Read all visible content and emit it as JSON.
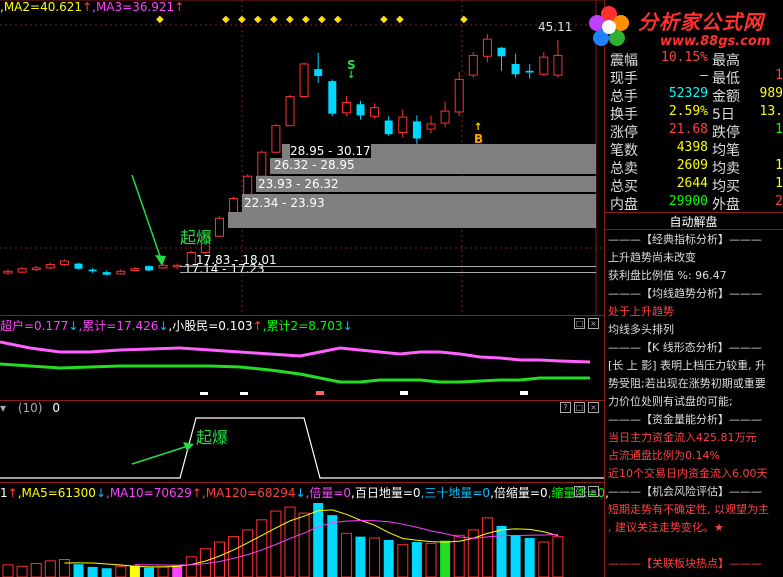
{
  "top_indicators": [
    {
      "text": ",MA2=40.621",
      "color": "#ffff00"
    },
    {
      "text": "↑",
      "color": "#ff4040"
    },
    {
      "text": ",MA3=36.921",
      "color": "#ff40ff"
    },
    {
      "text": "↑",
      "color": "#ff4040"
    }
  ],
  "price_label": "45.11",
  "logo": {
    "text": "分析家公式网",
    "url": "www.88gs.com"
  },
  "signals": {
    "s": "S",
    "b": "B"
  },
  "boxes": [
    "28.95 - 30.17",
    "26.32 - 28.95",
    "23.93 - 26.32",
    "22.34 - 23.93",
    "17.83 - 18.01",
    "17.14 - 17.23"
  ],
  "qiba": "起爆",
  "panel1_indicators": [
    {
      "text": "超户=0.177",
      "color": "#ff40ff"
    },
    {
      "text": "↓",
      "color": "#00c0ff"
    },
    {
      "text": ",累计=17.426",
      "color": "#ff40ff"
    },
    {
      "text": "↓",
      "color": "#00c0ff"
    },
    {
      "text": ",小股民=0.103",
      "color": "#ffffff"
    },
    {
      "text": "↑",
      "color": "#ff4040"
    },
    {
      "text": ",累计2=8.703",
      "color": "#00ff00"
    },
    {
      "text": "↓",
      "color": "#00c0ff"
    }
  ],
  "panel2_header": {
    "prefix": "▾",
    "paren": "(10)",
    "value": "0"
  },
  "panel3_indicators": [
    {
      "text": "1",
      "color": "#ffffff"
    },
    {
      "text": "↑",
      "color": "#ff4040"
    },
    {
      "text": ",MA5=61300",
      "color": "#ffff00"
    },
    {
      "text": "↓",
      "color": "#00c0ff"
    },
    {
      "text": ",MA10=70629",
      "color": "#ff40ff"
    },
    {
      "text": "↑",
      "color": "#ff4040"
    },
    {
      "text": ",MA120=68294",
      "color": "#ff4040"
    },
    {
      "text": "↓",
      "color": "#00c0ff"
    },
    {
      "text": ",倍量=0",
      "color": "#ff40ff"
    },
    {
      "text": ",百日地量=0",
      "color": "#ffffff"
    },
    {
      "text": ",三十地量=0",
      "color": "#00c0ff"
    },
    {
      "text": ",倍缩量=0",
      "color": "#ffffff"
    },
    {
      "text": ",缩量涨=0",
      "color": "#00ff00"
    },
    {
      "text": ",",
      "color": "#ffffff"
    }
  ],
  "quote": {
    "rows": [
      {
        "l1": "震幅",
        "v1": "10.15%",
        "c1": "#ff4040",
        "l2": "最高",
        "v2": "",
        "c2": "#ff4040"
      },
      {
        "l1": "现手",
        "v1": "—",
        "c1": "#dddddd",
        "l2": "最低",
        "v2": "1",
        "c2": "#ff4040"
      },
      {
        "l1": "总手",
        "v1": "52329",
        "c1": "#00ffff",
        "l2": "金额",
        "v2": "989",
        "c2": "#ffff00"
      },
      {
        "l1": "换手",
        "v1": "2.59%",
        "c1": "#ffff00",
        "l2": "5日",
        "v2": "13.",
        "c2": "#ffff00"
      },
      {
        "l1": "涨停",
        "v1": "21.68",
        "c1": "#ff4040",
        "l2": "跌停",
        "v2": "1",
        "c2": "#00ff00"
      },
      {
        "l1": "笔数",
        "v1": "4398",
        "c1": "#ffff00",
        "l2": "均笔",
        "v2": "",
        "c2": "#ffff00"
      },
      {
        "l1": "总卖",
        "v1": "2609",
        "c1": "#ffff00",
        "l2": "均卖",
        "v2": "1",
        "c2": "#ffff00"
      },
      {
        "l1": "总买",
        "v1": "2644",
        "c1": "#ffff00",
        "l2": "均买",
        "v2": "1",
        "c2": "#ffff00"
      },
      {
        "l1": "内盘",
        "v1": "29900",
        "c1": "#00ff00",
        "l2": "外盘",
        "v2": "2",
        "c2": "#ff4040"
      }
    ]
  },
  "auto_title": "自动解盘",
  "analysis": [
    {
      "text": "———【经典指标分析】———",
      "color": "#dddddd"
    },
    {
      "text": "上升趋势尚未改变",
      "color": "#dddddd"
    },
    {
      "text": "获利盘比例值 %: 96.47",
      "color": "#dddddd"
    },
    {
      "text": "———【均线趋势分析】———",
      "color": "#dddddd"
    },
    {
      "text": "处于上升趋势",
      "color": "#ff4040"
    },
    {
      "text": "均线多头排列",
      "color": "#dddddd"
    },
    {
      "text": "———【K 线形态分析】———",
      "color": "#dddddd"
    },
    {
      "text": "[长 上 影] 表明上档压力较重, 升",
      "color": "#dddddd"
    },
    {
      "text": "势受阻;若出现在涨势初期或重要",
      "color": "#dddddd"
    },
    {
      "text": "力价位处则有试盘的可能;",
      "color": "#dddddd"
    },
    {
      "text": "———【资金量能分析】———",
      "color": "#dddddd"
    },
    {
      "text": "当日主力资金流入425.81万元",
      "color": "#ff4040"
    },
    {
      "text": "占流通盘比例为0.14%",
      "color": "#ff4040"
    },
    {
      "text": "近10个交易日内资金流入6.00天",
      "color": "#ff4040"
    },
    {
      "text": "———【机会风险评估】———",
      "color": "#dddddd"
    },
    {
      "text": "短期走势有不确定性, 以观望为主",
      "color": "#ff4040"
    },
    {
      "text": ", 建议关注走势变化。★",
      "color": "#ff4040"
    },
    {
      "text": "",
      "color": "#dddddd"
    },
    {
      "text": "———【关联板块热点】———",
      "color": "#ff4040"
    }
  ],
  "chart_data": {
    "type": "candlestick",
    "price_tick": "45.11",
    "candles": [
      {
        "o": 17.2,
        "c": 17.4,
        "h": 17.6,
        "l": 17.0
      },
      {
        "o": 17.3,
        "c": 17.7,
        "h": 17.9,
        "l": 17.2
      },
      {
        "o": 17.6,
        "c": 17.8,
        "h": 18.0,
        "l": 17.4
      },
      {
        "o": 17.8,
        "c": 18.2,
        "h": 18.4,
        "l": 17.6
      },
      {
        "o": 18.2,
        "c": 18.6,
        "h": 18.8,
        "l": 18.0
      },
      {
        "o": 18.3,
        "c": 17.7,
        "h": 18.4,
        "l": 17.6
      },
      {
        "o": 17.6,
        "c": 17.4,
        "h": 17.8,
        "l": 17.2
      },
      {
        "o": 17.3,
        "c": 17.0,
        "h": 17.5,
        "l": 16.9
      },
      {
        "o": 17.1,
        "c": 17.4,
        "h": 17.6,
        "l": 17.0
      },
      {
        "o": 17.5,
        "c": 17.7,
        "h": 17.9,
        "l": 17.4
      },
      {
        "o": 18.0,
        "c": 17.5,
        "h": 18.1,
        "l": 17.4
      },
      {
        "o": 17.8,
        "c": 18.1,
        "h": 18.3,
        "l": 17.7
      },
      {
        "o": 18.0,
        "c": 18.1,
        "h": 18.3,
        "l": 17.6
      },
      {
        "o": 18.1,
        "c": 19.6,
        "h": 19.8,
        "l": 18.0
      },
      {
        "o": 19.6,
        "c": 21.5,
        "h": 21.7,
        "l": 19.4
      },
      {
        "o": 21.5,
        "c": 23.6,
        "h": 23.8,
        "l": 21.4
      },
      {
        "o": 23.6,
        "c": 25.9,
        "h": 26.1,
        "l": 23.5
      },
      {
        "o": 25.9,
        "c": 28.5,
        "h": 28.7,
        "l": 25.8
      },
      {
        "o": 28.5,
        "c": 31.3,
        "h": 31.5,
        "l": 28.4
      },
      {
        "o": 31.3,
        "c": 34.4,
        "h": 34.6,
        "l": 31.2
      },
      {
        "o": 34.4,
        "c": 37.8,
        "h": 38.0,
        "l": 34.3
      },
      {
        "o": 37.8,
        "c": 41.6,
        "h": 41.8,
        "l": 37.7
      },
      {
        "o": 41.0,
        "c": 40.2,
        "h": 42.9,
        "l": 39.4
      },
      {
        "o": 39.6,
        "c": 35.8,
        "h": 39.8,
        "l": 35.5
      },
      {
        "o": 35.9,
        "c": 37.1,
        "h": 37.9,
        "l": 35.5
      },
      {
        "o": 36.9,
        "c": 35.6,
        "h": 37.3,
        "l": 35.1
      },
      {
        "o": 35.5,
        "c": 36.5,
        "h": 37.0,
        "l": 35.2
      },
      {
        "o": 35.0,
        "c": 33.4,
        "h": 35.5,
        "l": 33.2
      },
      {
        "o": 33.6,
        "c": 35.4,
        "h": 36.3,
        "l": 33.0
      },
      {
        "o": 34.9,
        "c": 32.9,
        "h": 35.6,
        "l": 31.9
      },
      {
        "o": 34.0,
        "c": 34.6,
        "h": 35.6,
        "l": 33.5
      },
      {
        "o": 34.7,
        "c": 36.1,
        "h": 37.2,
        "l": 34.2
      },
      {
        "o": 36.0,
        "c": 39.8,
        "h": 40.7,
        "l": 35.5
      },
      {
        "o": 40.3,
        "c": 42.6,
        "h": 43.0,
        "l": 40.0
      },
      {
        "o": 42.5,
        "c": 44.5,
        "h": 45.1,
        "l": 41.8
      },
      {
        "o": 43.5,
        "c": 42.5,
        "h": 43.6,
        "l": 40.8
      },
      {
        "o": 41.6,
        "c": 40.4,
        "h": 42.8,
        "l": 40.0
      },
      {
        "o": 40.8,
        "c": 40.6,
        "h": 41.6,
        "l": 39.9
      },
      {
        "o": 40.4,
        "c": 42.4,
        "h": 43.0,
        "l": 40.2
      },
      {
        "o": 40.3,
        "c": 42.6,
        "h": 44.4,
        "l": 40.0
      }
    ],
    "volume": [
      18000,
      16000,
      20000,
      24000,
      26000,
      19000,
      15000,
      13000,
      16000,
      17000,
      14000,
      15000,
      17000,
      30000,
      42000,
      52000,
      60000,
      70000,
      85000,
      98000,
      104000,
      95000,
      110000,
      92000,
      65000,
      60000,
      58000,
      55000,
      48000,
      52000,
      50000,
      54000,
      62000,
      70000,
      88000,
      76000,
      62000,
      58000,
      52000,
      60000
    ]
  }
}
